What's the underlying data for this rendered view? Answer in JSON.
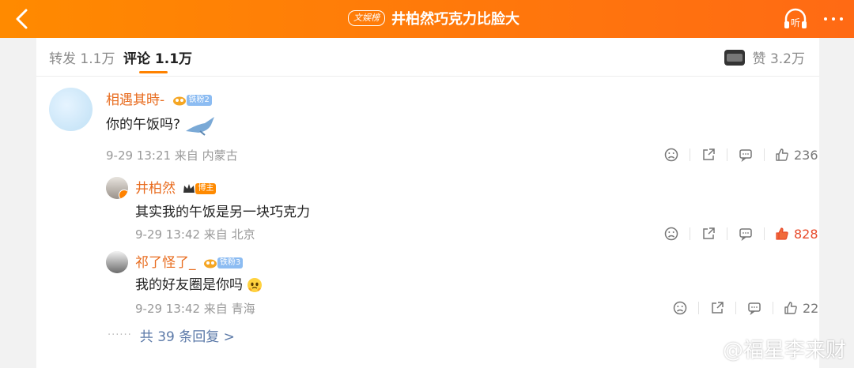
{
  "topbar": {
    "badge": "文娱榜",
    "title": "井柏然巧克力比脸大",
    "listen_label": "听"
  },
  "tabs": {
    "repost": "转发 1.1万",
    "comment": "评论 1.1万",
    "likes": "赞 3.2万"
  },
  "comment": {
    "user": "相遇其時-",
    "fan_level": "铁粉2",
    "text": "你的午饭吗?",
    "meta": "9-29 13:21 来自 内蒙古",
    "likes": "236"
  },
  "replies": [
    {
      "user": "井柏然",
      "badge": "博主",
      "text": "其实我的午饭是另一块巧克力",
      "meta": "9-29 13:42 来自 北京",
      "likes": "828"
    },
    {
      "user": "祁了怪了_",
      "fan_level": "铁粉3",
      "text": "我的好友圈是你吗",
      "meta": "9-29 13:42 来自 青海",
      "likes": "22"
    }
  ],
  "more_replies": "共 39 条回复 >",
  "watermark": "@福星李来财",
  "colors": {
    "topbar": "#ff7a0a",
    "username": "#e86c1f",
    "link": "#5b79a8",
    "hot_like": "#e84a2a"
  }
}
